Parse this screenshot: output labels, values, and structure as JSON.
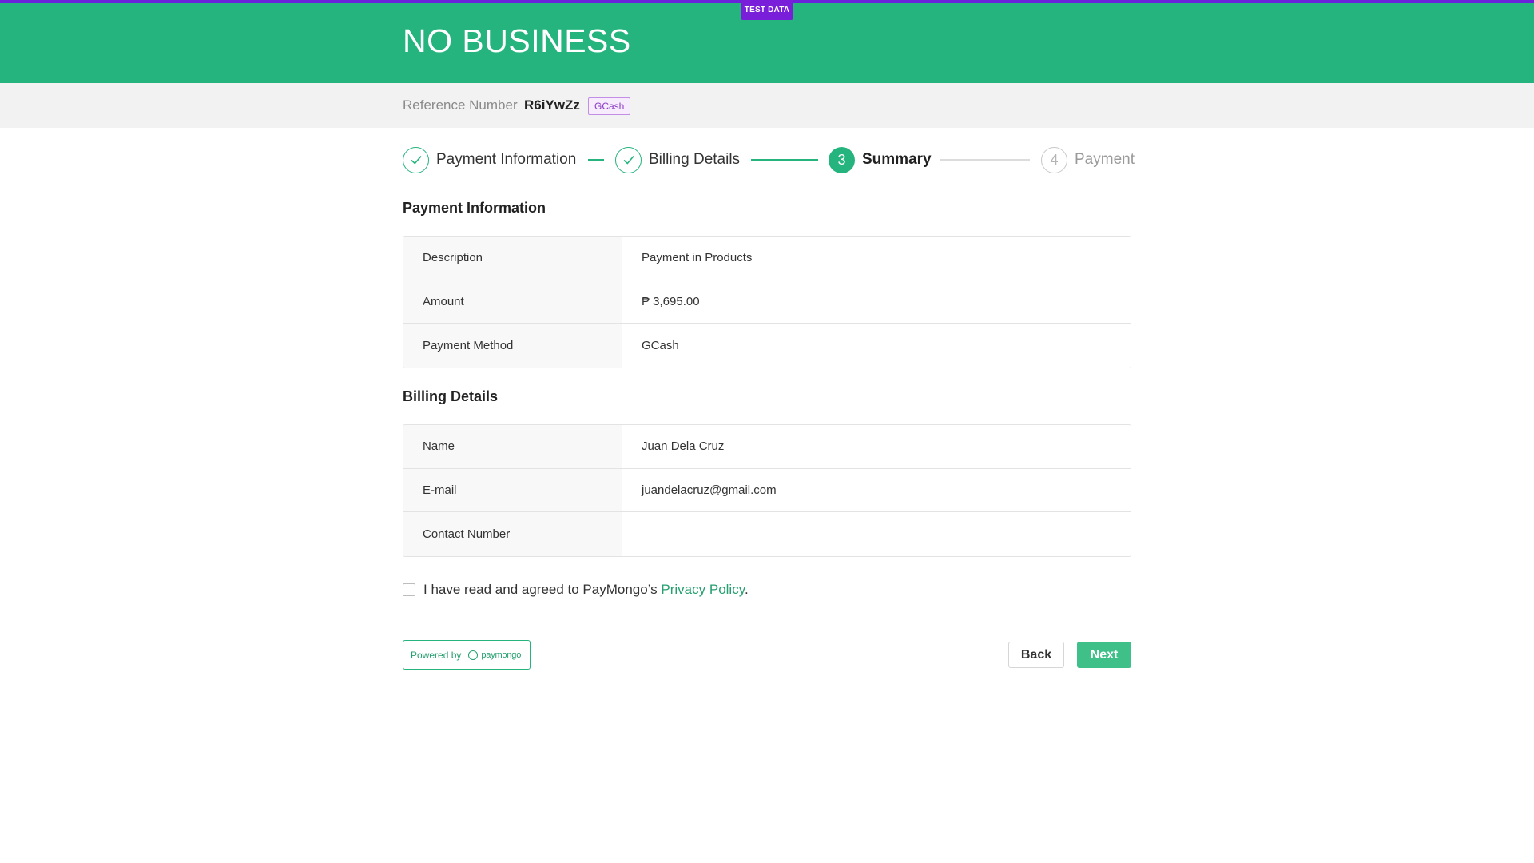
{
  "header": {
    "business_name": "NO BUSINESS",
    "test_badge": "TEST DATA"
  },
  "reference": {
    "label": "Reference Number",
    "value": "R6iYwZz",
    "method_badge": "GCash"
  },
  "stepper": {
    "steps": [
      {
        "label": "Payment Information",
        "state": "done"
      },
      {
        "label": "Billing Details",
        "state": "done"
      },
      {
        "label": "Summary",
        "state": "active",
        "number": "3"
      },
      {
        "label": "Payment",
        "state": "pending",
        "number": "4"
      }
    ]
  },
  "payment_information": {
    "title": "Payment Information",
    "rows": [
      {
        "key": "Description",
        "value": "Payment in Products"
      },
      {
        "key": "Amount",
        "value": "₱ 3,695.00"
      },
      {
        "key": "Payment Method",
        "value": "GCash"
      }
    ]
  },
  "billing_details": {
    "title": "Billing Details",
    "rows": [
      {
        "key": "Name",
        "value": "Juan Dela Cruz"
      },
      {
        "key": "E-mail",
        "value": "juandelacruz@gmail.com"
      },
      {
        "key": "Contact Number",
        "value": ""
      }
    ]
  },
  "agreement": {
    "text_before": "I have read and agreed to PayMongo’s ",
    "link_text": "Privacy Policy",
    "text_after": "."
  },
  "footer": {
    "powered_by": "Powered by",
    "brand": "paymongo",
    "back_label": "Back",
    "next_label": "Next"
  },
  "colors": {
    "brand_green": "#25b47e",
    "test_purple": "#7a1fd9"
  }
}
